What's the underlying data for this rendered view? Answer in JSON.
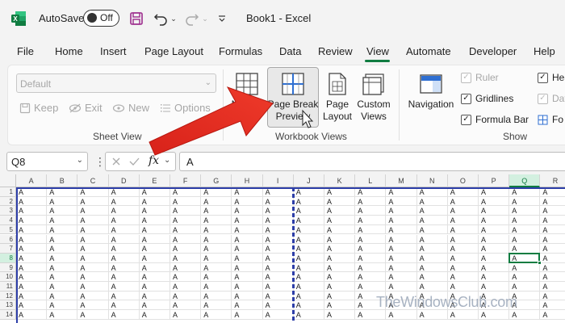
{
  "app": {
    "title": "Book1 - Excel",
    "autosave_label": "AutoSave",
    "autosave_state": "Off",
    "accent": "#107c41"
  },
  "tabs": [
    {
      "label": "File"
    },
    {
      "label": "Home"
    },
    {
      "label": "Insert"
    },
    {
      "label": "Page Layout"
    },
    {
      "label": "Formulas"
    },
    {
      "label": "Data"
    },
    {
      "label": "Review"
    },
    {
      "label": "View",
      "active": true
    },
    {
      "label": "Automate"
    },
    {
      "label": "Developer"
    },
    {
      "label": "Help"
    }
  ],
  "ribbon": {
    "sheet_view": {
      "dropdown_value": "Default",
      "keep": "Keep",
      "exit": "Exit",
      "new": "New",
      "options": "Options",
      "group_label": "Sheet View"
    },
    "workbook_views": {
      "normal": "Normal",
      "page_break_line1": "Page Break",
      "page_break_line2": "Preview",
      "page_layout_line1": "Page",
      "page_layout_line2": "Layout",
      "custom_line1": "Custom",
      "custom_line2": "Views",
      "group_label": "Workbook Views"
    },
    "show": {
      "navigation": "Navigation",
      "ruler": "Ruler",
      "gridlines": "Gridlines",
      "formula_bar": "Formula Bar",
      "headings_partial": "Hea",
      "data_partial": "Dat",
      "focus_partial": "Fo",
      "group_label": "Show"
    }
  },
  "formula_bar": {
    "name_box": "Q8",
    "fx": "fx",
    "content": "A"
  },
  "grid": {
    "columns": [
      "A",
      "B",
      "C",
      "D",
      "E",
      "F",
      "G",
      "H",
      "I",
      "J",
      "K",
      "L",
      "M",
      "N",
      "O",
      "P",
      "Q",
      "R"
    ],
    "rows": [
      "1",
      "2",
      "3",
      "4",
      "5",
      "6",
      "7",
      "8",
      "9",
      "10",
      "11",
      "12",
      "13",
      "14"
    ],
    "cell_value": "A",
    "selected_column": "Q",
    "selected_row": "8"
  },
  "watermark": "TheWindowsClub.com"
}
